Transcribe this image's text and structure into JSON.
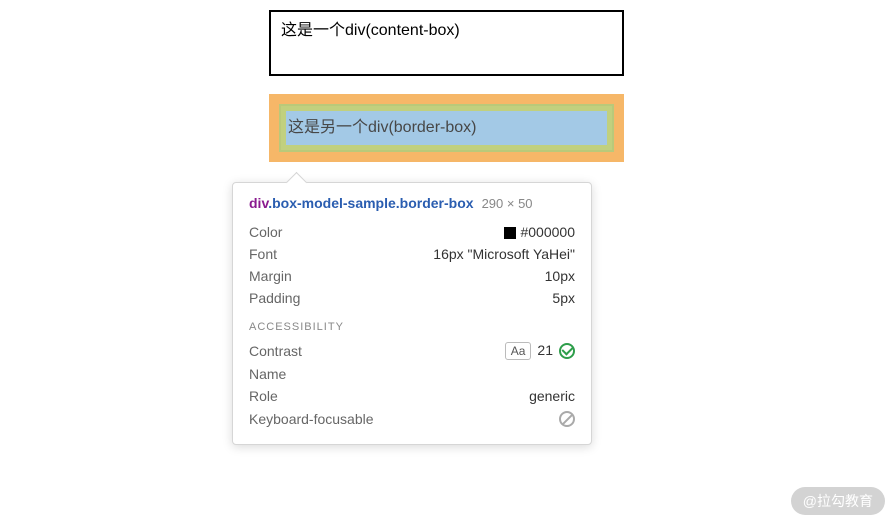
{
  "boxes": {
    "content_box_text": "这是一个div(content-box)",
    "border_box_text": "这是另一个div(border-box)"
  },
  "tooltip": {
    "selector_tag": "div",
    "selector_classes": ".box-model-sample.border-box",
    "dimensions": "290 × 50",
    "rows": {
      "color": {
        "label": "Color",
        "value": "#000000"
      },
      "font": {
        "label": "Font",
        "value": "16px \"Microsoft YaHei\""
      },
      "margin": {
        "label": "Margin",
        "value": "10px"
      },
      "padding": {
        "label": "Padding",
        "value": "5px"
      }
    },
    "accessibility_title": "ACCESSIBILITY",
    "a11y": {
      "contrast": {
        "label": "Contrast",
        "badge": "Aa",
        "value": "21"
      },
      "name": {
        "label": "Name",
        "value": ""
      },
      "role": {
        "label": "Role",
        "value": "generic"
      },
      "keyboard": {
        "label": "Keyboard-focusable"
      }
    }
  },
  "watermark": "@拉勾教育"
}
